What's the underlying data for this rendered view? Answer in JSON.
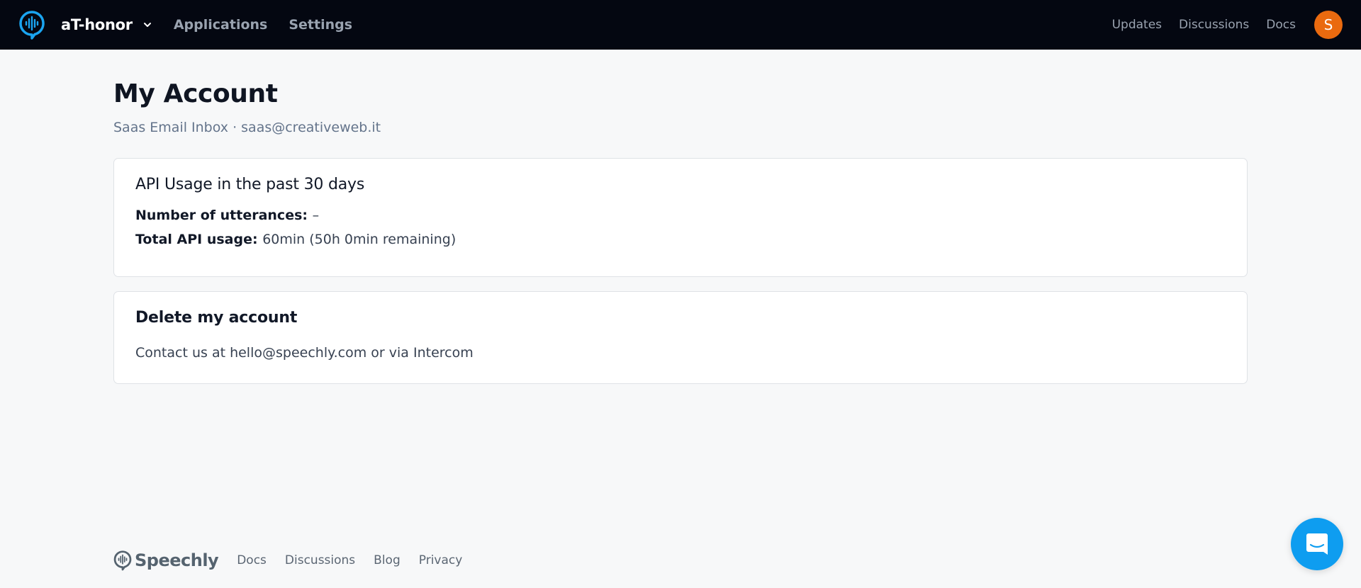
{
  "topbar": {
    "app_name": "aT-honor",
    "nav_left": [
      "Applications",
      "Settings"
    ],
    "nav_right": [
      "Updates",
      "Discussions",
      "Docs"
    ],
    "avatar_initial": "S",
    "colors": {
      "background": "#040711",
      "brand": "#1aa4f0",
      "avatar": "#ea6a0f"
    }
  },
  "page": {
    "title": "My Account",
    "subtitle": "Saas Email Inbox · saas@creativeweb.it"
  },
  "usage_card": {
    "title": "API Usage in the past 30 days",
    "utterances_label": "Number of utterances:",
    "utterances_value": "–",
    "total_label": "Total API usage:",
    "total_value": "60min (50h 0min remaining)"
  },
  "delete_card": {
    "title": "Delete my account",
    "text": "Contact us at hello@speechly.com or via Intercom"
  },
  "footer": {
    "brand": "Speechly",
    "links": [
      "Docs",
      "Discussions",
      "Blog",
      "Privacy"
    ]
  },
  "intercom": {
    "icon": "chat-icon",
    "color": "#0e9df0"
  }
}
